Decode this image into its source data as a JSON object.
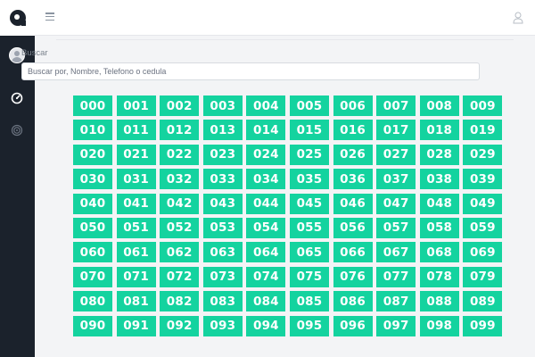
{
  "search": {
    "label": "Buscar",
    "placeholder": "Buscar por, Nombre, Telefono o cedula",
    "value": ""
  },
  "sidebar": {
    "icons": [
      "dashboard-icon",
      "target-icon"
    ]
  },
  "colors": {
    "accent": "#14d39f",
    "sidebar": "#1b222c"
  },
  "numbers": [
    "000",
    "001",
    "002",
    "003",
    "004",
    "005",
    "006",
    "007",
    "008",
    "009",
    "010",
    "011",
    "012",
    "013",
    "014",
    "015",
    "016",
    "017",
    "018",
    "019",
    "020",
    "021",
    "022",
    "023",
    "024",
    "025",
    "026",
    "027",
    "028",
    "029",
    "030",
    "031",
    "032",
    "033",
    "034",
    "035",
    "036",
    "037",
    "038",
    "039",
    "040",
    "041",
    "042",
    "043",
    "044",
    "045",
    "046",
    "047",
    "048",
    "049",
    "050",
    "051",
    "052",
    "053",
    "054",
    "055",
    "056",
    "057",
    "058",
    "059",
    "060",
    "061",
    "062",
    "063",
    "064",
    "065",
    "066",
    "067",
    "068",
    "069",
    "070",
    "071",
    "072",
    "073",
    "074",
    "075",
    "076",
    "077",
    "078",
    "079",
    "080",
    "081",
    "082",
    "083",
    "084",
    "085",
    "086",
    "087",
    "088",
    "089",
    "090",
    "091",
    "092",
    "093",
    "094",
    "095",
    "096",
    "097",
    "098",
    "099"
  ]
}
